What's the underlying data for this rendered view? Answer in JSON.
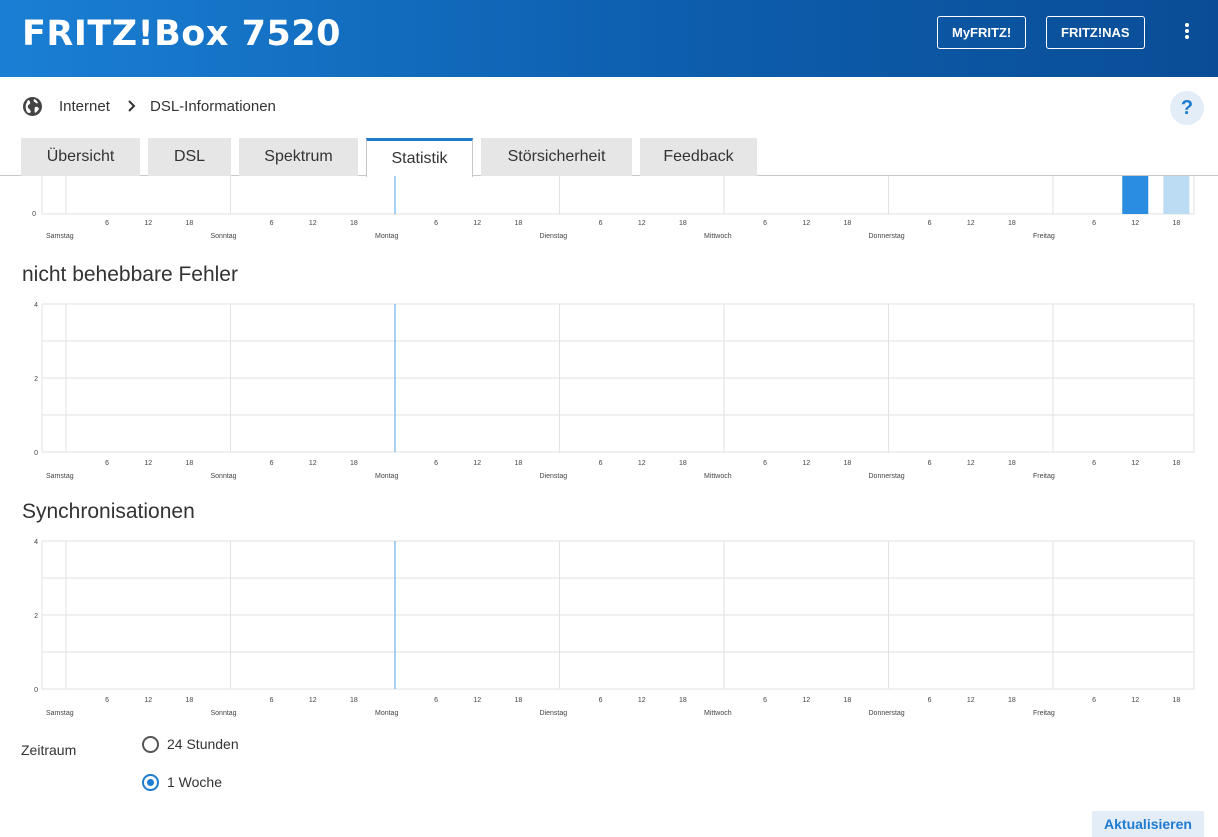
{
  "header": {
    "title": "FRITZ!Box 7520",
    "buttons": [
      "MyFRITZ!",
      "FRITZ!NAS"
    ],
    "menu_icon": "more-vertical-icon"
  },
  "breadcrumb": {
    "icon": "globe-icon",
    "items": [
      "Internet",
      "DSL-Informationen"
    ],
    "separator_icon": "chevron-right-icon",
    "help_label": "?"
  },
  "tabs": [
    {
      "label": "Übersicht",
      "active": false
    },
    {
      "label": "DSL",
      "active": false
    },
    {
      "label": "Spektrum",
      "active": false
    },
    {
      "label": "Statistik",
      "active": true
    },
    {
      "label": "Störsicherheit",
      "active": false
    },
    {
      "label": "Feedback",
      "active": false
    }
  ],
  "sections": {
    "uncorrectable_title": "nicht behebbare Fehler",
    "sync_title": "Synchronisationen"
  },
  "colors": {
    "accent": "#1f7bd0",
    "bar_dark": "#2b8de0",
    "bar_light": "#bcdcf4",
    "grid": "#e2e2e2",
    "current_marker": "#6fb3e8"
  },
  "chart_data": [
    {
      "type": "bar",
      "title": "",
      "days": [
        "Samstag",
        "Sonntag",
        "Montag",
        "Dienstag",
        "Mittwoch",
        "Donnerstag",
        "Freitag"
      ],
      "hour_ticks": [
        "6",
        "12",
        "18"
      ],
      "y_ticks": [
        "0"
      ],
      "current_marker_day": "Montag",
      "bars": [
        {
          "day": "Freitag",
          "hour": 12,
          "style": "dark"
        },
        {
          "day": "Freitag",
          "hour": 18,
          "style": "light"
        }
      ],
      "note": "partially scrolled out of view"
    },
    {
      "type": "bar",
      "title": "nicht behebbare Fehler",
      "days": [
        "Samstag",
        "Sonntag",
        "Montag",
        "Dienstag",
        "Mittwoch",
        "Donnerstag",
        "Freitag"
      ],
      "hour_ticks": [
        "6",
        "12",
        "18"
      ],
      "y_ticks": [
        "0",
        "2",
        "4"
      ],
      "ylim": [
        0,
        4
      ],
      "current_marker_day": "Montag",
      "bars": []
    },
    {
      "type": "bar",
      "title": "Synchronisationen",
      "days": [
        "Samstag",
        "Sonntag",
        "Montag",
        "Dienstag",
        "Mittwoch",
        "Donnerstag",
        "Freitag"
      ],
      "hour_ticks": [
        "6",
        "12",
        "18"
      ],
      "y_ticks": [
        "0",
        "2",
        "4"
      ],
      "ylim": [
        0,
        4
      ],
      "current_marker_day": "Montag",
      "bars": []
    }
  ],
  "period": {
    "label": "Zeitraum",
    "options": [
      {
        "label": "24 Stunden",
        "checked": false
      },
      {
        "label": "1 Woche",
        "checked": true
      }
    ]
  },
  "refresh_label": "Aktualisieren"
}
